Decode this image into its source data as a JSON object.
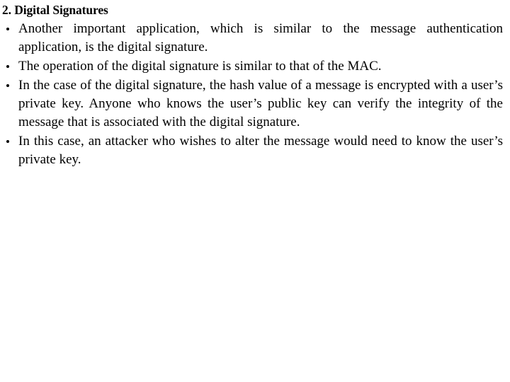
{
  "slide": {
    "background_color": "#ffffff",
    "text_color": "#000000",
    "heading": "2. Digital Signatures",
    "bullet_glyph": "•",
    "bullets": [
      "Another important application, which is similar to the message authentication application, is the digital signature.",
      "The operation of the digital signature is similar to that of the MAC.",
      "In the case of the digital signature, the hash value of a message is encrypted with a user’s private key. Anyone who knows the user’s public key can verify the integrity of the message that is associated with the digital signature.",
      "In this case, an attacker who wishes to alter the message would need to know the user’s private key."
    ]
  }
}
